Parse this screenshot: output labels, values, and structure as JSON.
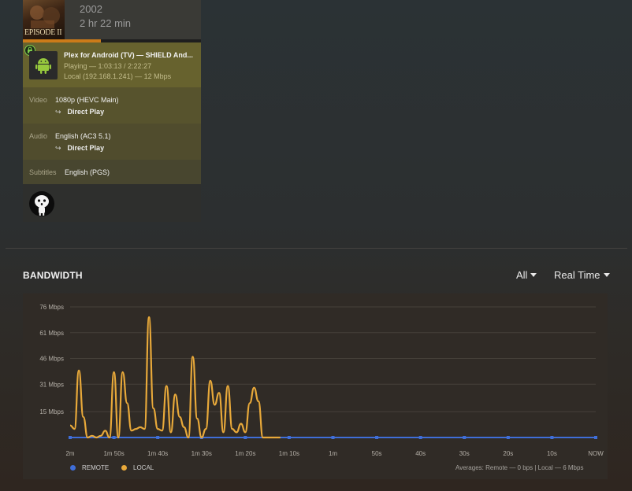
{
  "session": {
    "poster_text": "EPISODE II",
    "year": "2002",
    "runtime": "2 hr 22 min",
    "progress_fraction": 0.44,
    "player": {
      "name": "Plex for Android (TV)  —  SHIELD And...",
      "state": "Playing — 1:03:13 / 2:22:27",
      "connection": "Local (192.168.1.241) — 12 Mbps",
      "icon": "android-icon",
      "secure_icon": "lock-icon"
    },
    "video": {
      "label": "Video",
      "value": "1080p (HEVC Main)",
      "decision": "Direct Play"
    },
    "audio": {
      "label": "Audio",
      "value": "English (AC3 5.1)",
      "decision": "Direct Play"
    },
    "subtitles": {
      "label": "Subtitles",
      "value": "English (PGS)"
    },
    "user": {
      "avatar_icon": "kodama-avatar"
    }
  },
  "bandwidth": {
    "title": "BANDWIDTH",
    "filter_label": "All",
    "range_label": "Real Time",
    "averages_text": "Averages: Remote — 0 bps | Local — 6 Mbps"
  },
  "colors": {
    "local": "#e8a93a",
    "remote": "#3f6ed8",
    "accent": "#cc7b19"
  },
  "chart_data": {
    "type": "line",
    "title": "",
    "ylabel": "",
    "xlabel": "",
    "y_ticks": [
      "76 Mbps",
      "61 Mbps",
      "46 Mbps",
      "31 Mbps",
      "15 Mbps"
    ],
    "y_tick_values": [
      76,
      61,
      46,
      31,
      15
    ],
    "ylim": [
      0,
      76
    ],
    "xlim": [
      120,
      0
    ],
    "x_ticks": [
      "2m",
      "1m 50s",
      "1m 40s",
      "1m 30s",
      "1m 20s",
      "1m 10s",
      "1m",
      "50s",
      "40s",
      "30s",
      "20s",
      "10s",
      "NOW"
    ],
    "x_tick_values": [
      120,
      110,
      100,
      90,
      80,
      70,
      60,
      50,
      40,
      30,
      20,
      10,
      0
    ],
    "grid": true,
    "legend_position": "bottom-left",
    "series": [
      {
        "name": "REMOTE",
        "color": "#3f6ed8",
        "x": [
          120,
          110,
          100,
          90,
          80,
          70,
          60,
          50,
          40,
          30,
          20,
          10,
          0
        ],
        "values": [
          0,
          0,
          0,
          0,
          0,
          0,
          0,
          0,
          0,
          0,
          0,
          0,
          0
        ]
      },
      {
        "name": "LOCAL",
        "color": "#e8a93a",
        "x": [
          120,
          119,
          118,
          117,
          116,
          115,
          114,
          113,
          112,
          111,
          110,
          109,
          108,
          107,
          106,
          105,
          104,
          103,
          102,
          101,
          100,
          99,
          98,
          97,
          96,
          95,
          94,
          93,
          92,
          91,
          90,
          89,
          88,
          87,
          86,
          85,
          84,
          83,
          82,
          81,
          80,
          79,
          78,
          77,
          76,
          75,
          74,
          73,
          72
        ],
        "values": [
          7,
          5,
          39,
          12,
          0,
          1,
          0,
          1,
          4,
          0,
          38,
          0,
          38,
          20,
          4,
          5,
          6,
          5,
          70,
          17,
          5,
          4,
          30,
          3,
          25,
          12,
          6,
          0,
          47,
          11,
          0,
          5,
          33,
          19,
          26,
          3,
          30,
          5,
          3,
          8,
          3,
          20,
          29,
          21,
          0,
          0,
          0,
          0,
          0
        ]
      }
    ]
  }
}
